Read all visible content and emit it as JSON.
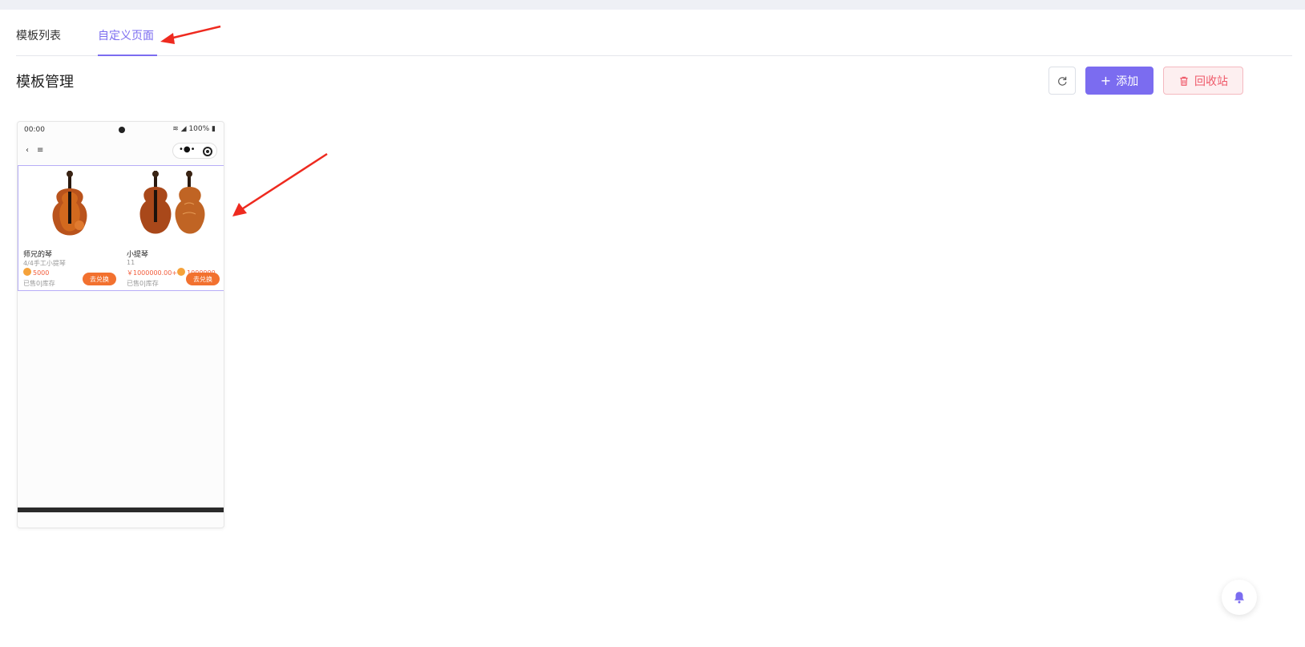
{
  "tabs": [
    {
      "label": "模板列表"
    },
    {
      "label": "自定义页面"
    }
  ],
  "active_tab": "自定义页面",
  "page_title": "模板管理",
  "toolbar": {
    "refresh_icon": "refresh-icon",
    "add_label": "添加",
    "recycle_label": "回收站"
  },
  "preview": {
    "status_time": "00:00",
    "status_battery": "100%",
    "nav_back": "‹",
    "nav_menu": "≡",
    "items": [
      {
        "name": "师兄的琴",
        "subtitle": "4/4手工小提琴",
        "price_text": "5000",
        "stock_text": "已售0|库存",
        "button": "去兑换"
      },
      {
        "name": "小提琴",
        "subtitle": "11",
        "price_text": "￥1000000.00+",
        "price_coin": "1000000",
        "stock_text": "已售0|库存",
        "button": "去兑换"
      }
    ]
  },
  "colors": {
    "accent": "#7b6cf0",
    "danger": "#ef5a6a",
    "exchange": "#f2712f"
  }
}
